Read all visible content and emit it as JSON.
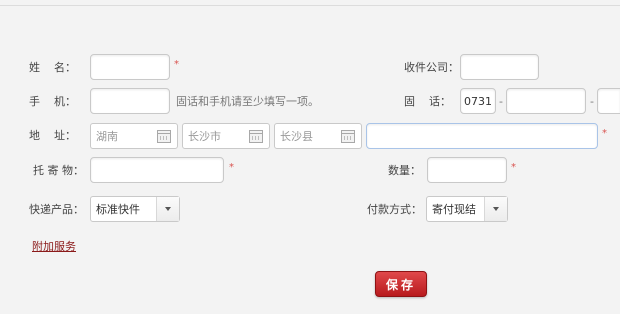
{
  "form": {
    "name_label": "姓    名：",
    "name_required": "*",
    "company_label": "收件公司：",
    "phone_label": "手    机：",
    "phone_hint": "固话和手机请至少填写一项。",
    "tel_label": "固    话：",
    "tel_area": "0731",
    "tel_dash1": "-",
    "tel_dash2": "-",
    "address_label": "地    址：",
    "province": "湖南",
    "city": "长沙市",
    "county": "长沙县",
    "address_required": "*",
    "goods_label": "托 寄 物：",
    "goods_required": "*",
    "quantity_label": "数量：",
    "quantity_required": "*",
    "product_label": "快递产品：",
    "product_value": "标准快件",
    "payment_label": "付款方式：",
    "payment_value": "寄付现结",
    "extra_service": "附加服务",
    "save": "保存"
  },
  "colors": {
    "accent": "#c0282b",
    "required": "#d9534f",
    "link": "#8b1a1a"
  }
}
